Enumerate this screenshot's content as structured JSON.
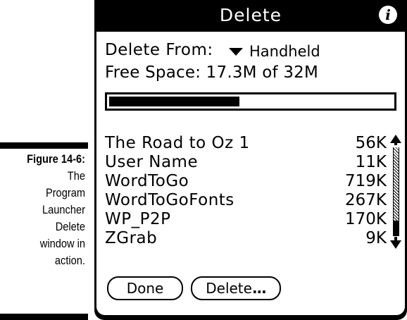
{
  "caption": {
    "figure_label": "Figure 14-6:",
    "text_lines": [
      "The",
      "Program",
      "Launcher",
      "Delete",
      "window in",
      "action."
    ]
  },
  "window": {
    "title": "Delete",
    "info_icon": "info-icon",
    "delete_from_label": "Delete From:",
    "delete_from_value": "Handheld",
    "free_space_text": "Free Space: 17.3M of 32M",
    "free_space_used_fraction": 0.46,
    "apps": [
      {
        "name": "The Road to Oz 1",
        "size": "56K"
      },
      {
        "name": "User Name",
        "size": "11K"
      },
      {
        "name": "WordToGo",
        "size": "719K"
      },
      {
        "name": "WordToGoFonts",
        "size": "267K"
      },
      {
        "name": "WP_P2P",
        "size": "170K"
      },
      {
        "name": "ZGrab",
        "size": "9K"
      }
    ],
    "buttons": {
      "done": "Done",
      "delete": "Delete",
      "delete_ellipsis": "..."
    }
  }
}
